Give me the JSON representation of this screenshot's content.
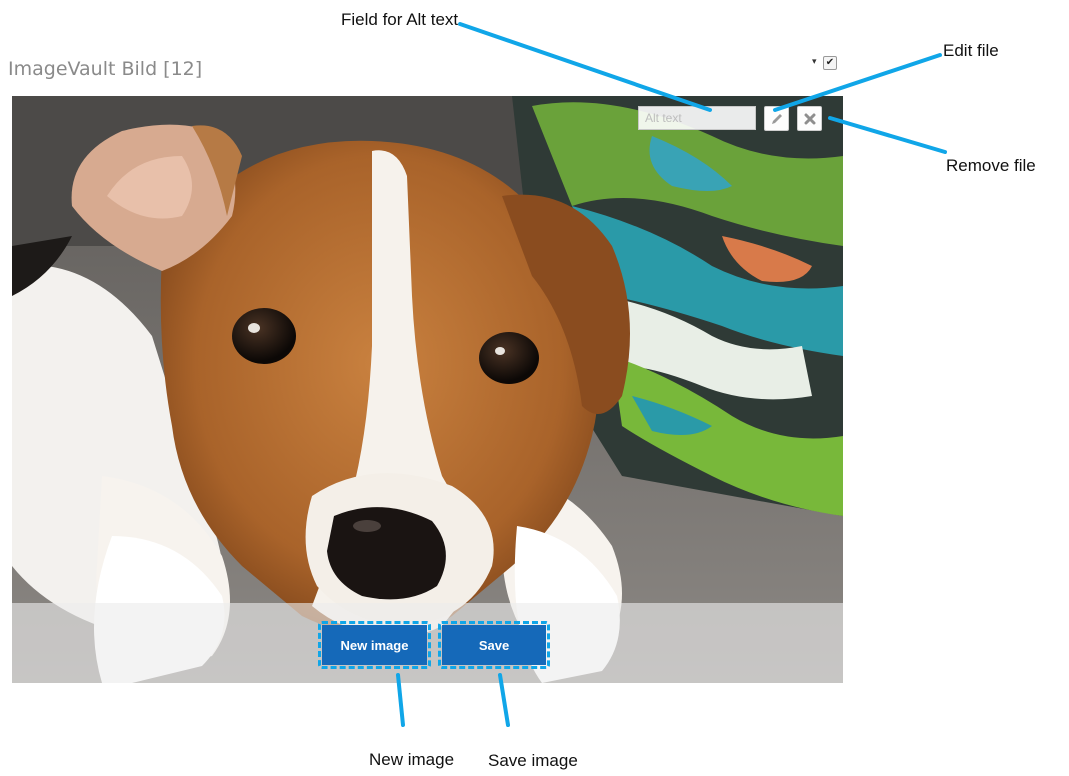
{
  "block": {
    "title": "ImageVault Bild [12]",
    "toggle_glyph": "▾",
    "checked": true
  },
  "image": {
    "subject": "puppy-photo",
    "alt_text_placeholder": "Alt text",
    "alt_text_value": ""
  },
  "toolbar": {
    "edit_icon": "pencil-icon",
    "remove_icon": "close-icon"
  },
  "actions": {
    "new_image_label": "New image",
    "save_label": "Save"
  },
  "annotations": {
    "alt_text_field": "Field for Alt text",
    "edit_file": "Edit file",
    "remove_file": "Remove file",
    "new_image": "New image",
    "save_image": "Save image"
  },
  "colors": {
    "button_blue": "#1569b9",
    "callout_blue": "#10a6e8",
    "title_gray": "#8a8a8a"
  }
}
